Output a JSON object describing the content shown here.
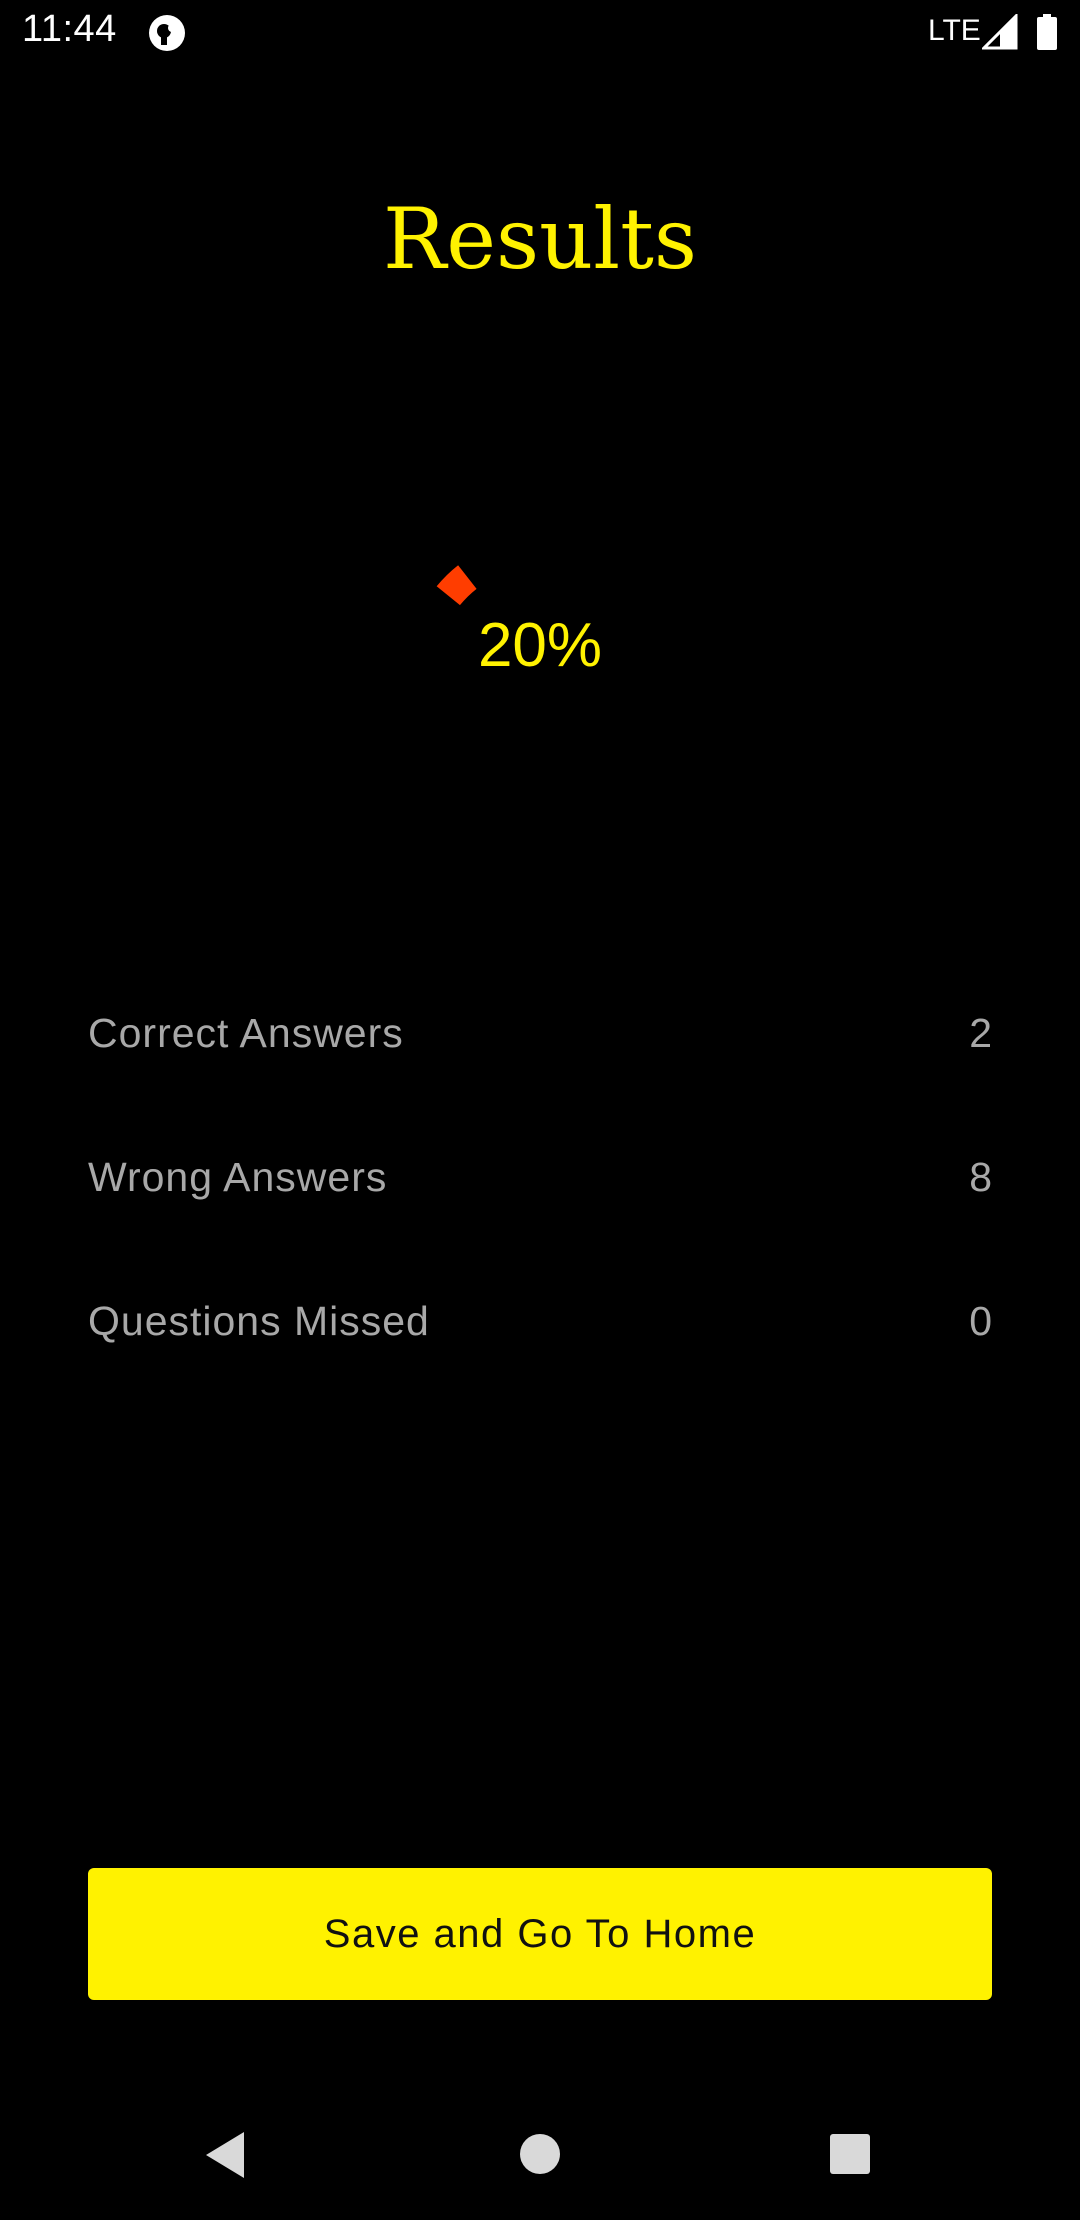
{
  "status_bar": {
    "time": "11:44",
    "network": "LTE",
    "icons": [
      "app-notification-icon",
      "signal-icon",
      "battery-icon"
    ]
  },
  "title": "Results",
  "score": {
    "percent_label": "20%",
    "percent_value": 20
  },
  "stats": [
    {
      "label": "Correct Answers",
      "value": "2"
    },
    {
      "label": "Wrong Answers",
      "value": "8"
    },
    {
      "label": "Questions Missed",
      "value": "0"
    }
  ],
  "button": {
    "label": "Save and Go To Home"
  },
  "colors": {
    "background": "#000000",
    "accent": "#fff200",
    "progress": "#ff3d00",
    "muted_text": "#a8a8a8"
  },
  "nav_bar": {
    "icons": [
      "back-icon",
      "home-icon",
      "recents-icon"
    ]
  }
}
